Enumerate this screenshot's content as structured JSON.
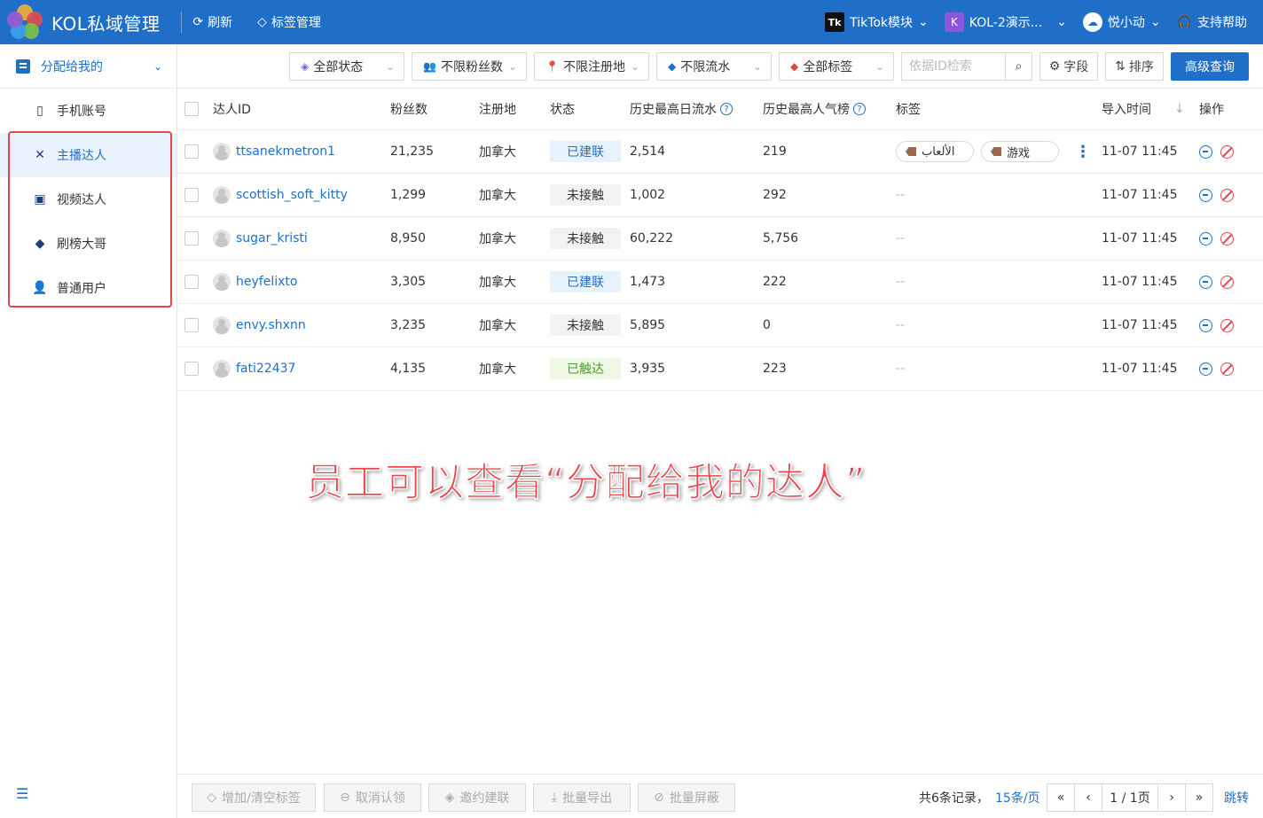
{
  "header": {
    "app_title": "KOL私域管理",
    "refresh": "刷新",
    "tag_manage": "标签管理",
    "tiktok_badge": "Tk",
    "module": "TikTok模块",
    "k_badge": "K",
    "workspace": "KOL-2演示...",
    "user": "悦小动",
    "help": "支持帮助"
  },
  "sidebar": {
    "section": "分配给我的",
    "items": [
      {
        "label": "手机账号",
        "icon": "phone-icon"
      },
      {
        "label": "主播达人",
        "icon": "broadcast-icon"
      },
      {
        "label": "视频达人",
        "icon": "video-icon"
      },
      {
        "label": "刷榜大哥",
        "icon": "diamond-icon"
      },
      {
        "label": "普通用户",
        "icon": "user-icon"
      }
    ],
    "active_index": 1
  },
  "filters": {
    "status": "全部状态",
    "fans": "不限粉丝数",
    "region": "不限注册地",
    "flow": "不限流水",
    "tags": "全部标签",
    "search_placeholder": "依据ID检索",
    "fields": "字段",
    "sort": "排序",
    "advanced": "高级查询"
  },
  "table": {
    "columns": [
      "达人ID",
      "粉丝数",
      "注册地",
      "状态",
      "历史最高日流水",
      "历史最高人气榜",
      "标签",
      "导入时间",
      "操作"
    ],
    "rows": [
      {
        "id": "ttsanekmetron1",
        "fans": "21,235",
        "region": "加拿大",
        "status": "已建联",
        "status_type": "blue",
        "flow": "2,514",
        "pop": "219",
        "tags": [
          "الألعاب",
          "游戏"
        ],
        "time": "11-07 11:45"
      },
      {
        "id": "scottish_soft_kitty",
        "fans": "1,299",
        "region": "加拿大",
        "status": "未接触",
        "status_type": "gray",
        "flow": "1,002",
        "pop": "292",
        "tags": [],
        "time": "11-07 11:45"
      },
      {
        "id": "sugar_kristi",
        "fans": "8,950",
        "region": "加拿大",
        "status": "未接触",
        "status_type": "gray",
        "flow": "60,222",
        "pop": "5,756",
        "tags": [],
        "time": "11-07 11:45"
      },
      {
        "id": "heyfelixto",
        "fans": "3,305",
        "region": "加拿大",
        "status": "已建联",
        "status_type": "blue",
        "flow": "1,473",
        "pop": "222",
        "tags": [],
        "time": "11-07 11:45"
      },
      {
        "id": "envy.shxnn",
        "fans": "3,235",
        "region": "加拿大",
        "status": "未接触",
        "status_type": "gray",
        "flow": "5,895",
        "pop": "0",
        "tags": [],
        "time": "11-07 11:45"
      },
      {
        "id": "fati22437",
        "fans": "4,135",
        "region": "加拿大",
        "status": "已触达",
        "status_type": "green",
        "flow": "3,935",
        "pop": "223",
        "tags": [],
        "time": "11-07 11:45"
      }
    ],
    "empty_tag": "--"
  },
  "annotation": "员工可以查看“分配给我的达人”",
  "bottom": {
    "actions": [
      "增加/清空标签",
      "取消认领",
      "邀约建联",
      "批量导出",
      "批量屏蔽"
    ],
    "total": "共6条记录，",
    "page_size": "15条/页",
    "page": "1 / 1页",
    "jump": "跳转"
  },
  "colors": {
    "primary": "#1f6fc9",
    "danger": "#e0464b"
  }
}
